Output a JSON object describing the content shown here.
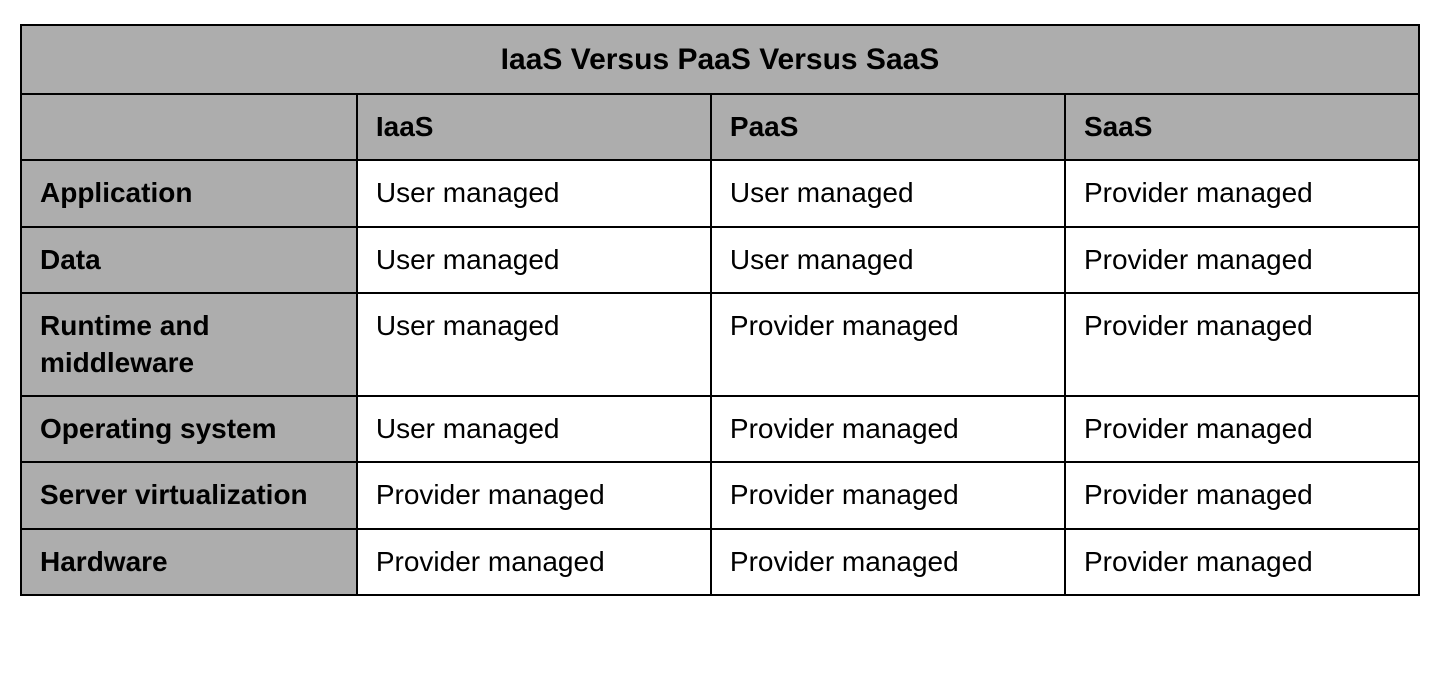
{
  "table": {
    "title": "IaaS Versus PaaS Versus SaaS",
    "columns": [
      "",
      "IaaS",
      "PaaS",
      "SaaS"
    ],
    "rows": [
      {
        "label": "Application",
        "iaas": "User managed",
        "paas": "User managed",
        "saas": "Provider managed"
      },
      {
        "label": "Data",
        "iaas": "User managed",
        "paas": "User managed",
        "saas": "Provider managed"
      },
      {
        "label": "Runtime and middleware",
        "iaas": "User managed",
        "paas": "Provider managed",
        "saas": "Provider managed"
      },
      {
        "label": "Operating system",
        "iaas": "User managed",
        "paas": "Provider managed",
        "saas": "Provider managed"
      },
      {
        "label": "Server virtualization",
        "iaas": "Provider managed",
        "paas": "Provider managed",
        "saas": "Provider managed"
      },
      {
        "label": "Hardware",
        "iaas": "Provider managed",
        "paas": "Provider managed",
        "saas": "Provider managed"
      }
    ]
  }
}
